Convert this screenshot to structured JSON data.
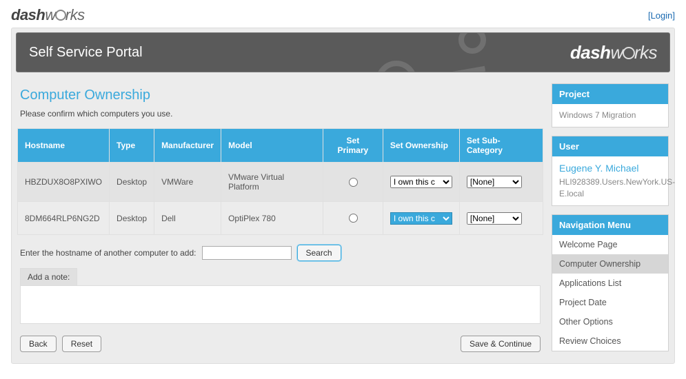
{
  "brand": {
    "dash": "dash",
    "works": "rks",
    "w": "w"
  },
  "top": {
    "login": "[Login]"
  },
  "hero": {
    "title": "Self Service Portal"
  },
  "page": {
    "title": "Computer Ownership",
    "intro": "Please confirm which computers you use."
  },
  "columns": {
    "hostname": "Hostname",
    "type": "Type",
    "manufacturer": "Manufacturer",
    "model": "Model",
    "setprimary": "Set Primary",
    "setownership": "Set Ownership",
    "setsubcat": "Set Sub-Category"
  },
  "rows": [
    {
      "hostname": "HBZDUX8O8PXIWO",
      "type": "Desktop",
      "manufacturer": "VMWare",
      "model": "VMware Virtual Platform",
      "ownership": "I own this c",
      "subcat": "[None]"
    },
    {
      "hostname": "8DM664RLP6NG2D",
      "type": "Desktop",
      "manufacturer": "Dell",
      "model": "OptiPlex 780",
      "ownership": "I own this c",
      "subcat": "[None]"
    }
  ],
  "add": {
    "label": "Enter the hostname of another computer to add:",
    "searchBtn": "Search"
  },
  "note": {
    "label": "Add a note:"
  },
  "buttons": {
    "back": "Back",
    "reset": "Reset",
    "save": "Save & Continue"
  },
  "side": {
    "project": {
      "title": "Project",
      "value": "Windows 7 Migration"
    },
    "user": {
      "title": "User",
      "name": "Eugene Y. Michael",
      "detail": "HLI928389.Users.NewYork.US-E.local"
    },
    "nav": {
      "title": "Navigation Menu",
      "items": [
        {
          "label": "Welcome Page",
          "active": false
        },
        {
          "label": "Computer Ownership",
          "active": true
        },
        {
          "label": "Applications List",
          "active": false
        },
        {
          "label": "Project Date",
          "active": false
        },
        {
          "label": "Other Options",
          "active": false
        },
        {
          "label": "Review Choices",
          "active": false
        }
      ]
    }
  }
}
